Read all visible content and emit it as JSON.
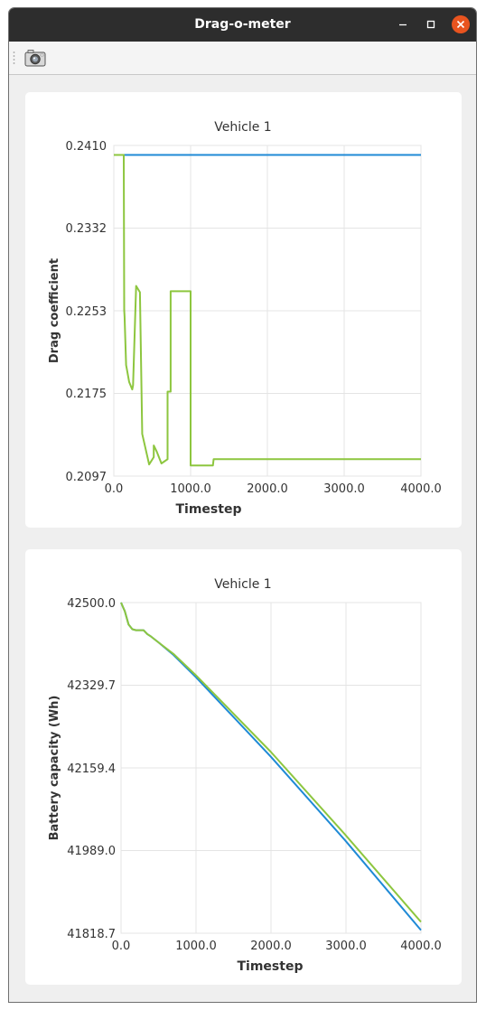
{
  "window": {
    "title": "Drag-o-meter"
  },
  "toolbar": {
    "camera_icon": "camera-icon"
  },
  "colors": {
    "series_blue": "#1f8ad6",
    "series_green": "#8dc63f",
    "grid": "#e4e4e4"
  },
  "charts": [
    {
      "title": "Vehicle 1",
      "xlabel": "Timestep",
      "ylabel": "Drag coefficient",
      "xticks": [
        "0.0",
        "1000.0",
        "2000.0",
        "3000.0",
        "4000.0"
      ],
      "yticks": [
        "0.2410",
        "0.2332",
        "0.2253",
        "0.2175",
        "0.2097"
      ]
    },
    {
      "title": "Vehicle 1",
      "xlabel": "Timestep",
      "ylabel": "Battery capacity (Wh)",
      "xticks": [
        "0.0",
        "1000.0",
        "2000.0",
        "3000.0",
        "4000.0"
      ],
      "yticks": [
        "42500.0",
        "42329.7",
        "42159.4",
        "41989.0",
        "41818.7"
      ]
    }
  ],
  "chart_data": [
    {
      "type": "line",
      "title": "Vehicle 1",
      "xlabel": "Timestep",
      "ylabel": "Drag coefficient",
      "xlim": [
        0,
        4000
      ],
      "ylim": [
        0.2097,
        0.241
      ],
      "grid": true,
      "series": [
        {
          "color": "#1f8ad6",
          "x": [
            0,
            4000
          ],
          "y": [
            0.2401,
            0.2401
          ]
        },
        {
          "color": "#8dc63f",
          "x": [
            0,
            130,
            135,
            140,
            160,
            170,
            200,
            240,
            250,
            290,
            340,
            370,
            370,
            460,
            520,
            520,
            560,
            620,
            700,
            700,
            740,
            740,
            980,
            1000,
            1000,
            1290,
            1300,
            4000
          ],
          "y": [
            0.2401,
            0.2401,
            0.2254,
            0.2248,
            0.2202,
            0.2198,
            0.2186,
            0.2179,
            0.2183,
            0.2277,
            0.2271,
            0.2139,
            0.2137,
            0.2108,
            0.2115,
            0.2126,
            0.212,
            0.2109,
            0.2113,
            0.2177,
            0.2177,
            0.2272,
            0.2272,
            0.2272,
            0.2107,
            0.2107,
            0.2113,
            0.2113
          ]
        }
      ]
    },
    {
      "type": "line",
      "title": "Vehicle 1",
      "xlabel": "Timestep",
      "ylabel": "Battery capacity (Wh)",
      "xlim": [
        0,
        4000
      ],
      "ylim": [
        41818.7,
        42500.0
      ],
      "grid": true,
      "series": [
        {
          "color": "#1f8ad6",
          "x": [
            0,
            50,
            100,
            150,
            200,
            300,
            350,
            400,
            500,
            700,
            1000,
            2000,
            3000,
            4000
          ],
          "y": [
            42500,
            42482,
            42455,
            42445,
            42443,
            42443,
            42435,
            42430,
            42418,
            42392,
            42346,
            42182,
            42008,
            41825
          ]
        },
        {
          "color": "#8dc63f",
          "x": [
            0,
            50,
            100,
            150,
            200,
            300,
            350,
            400,
            500,
            700,
            1000,
            2000,
            3000,
            4000
          ],
          "y": [
            42500,
            42482,
            42455,
            42445,
            42443,
            42443,
            42435,
            42430,
            42418,
            42394,
            42350,
            42192,
            42020,
            41842
          ]
        }
      ]
    }
  ]
}
